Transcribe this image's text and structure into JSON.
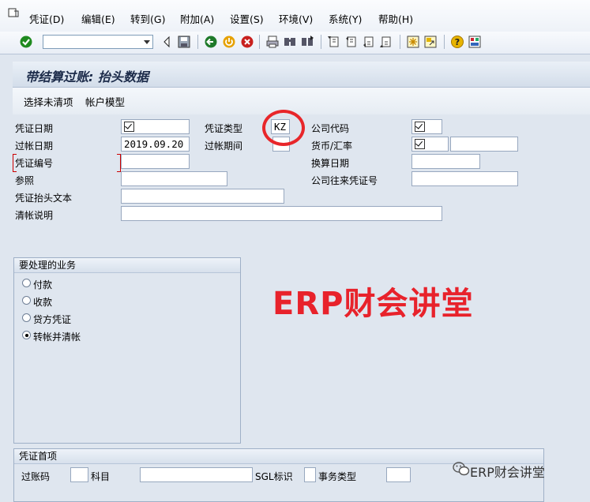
{
  "menu": [
    "凭证(D)",
    "编辑(E)",
    "转到(G)",
    "附加(A)",
    "设置(S)",
    "环境(V)",
    "系统(Y)",
    "帮助(H)"
  ],
  "toolbar": {
    "icons": [
      "enter-check-icon",
      "back-arrow-icon",
      "save-icon",
      "back-icon",
      "exit-icon",
      "cancel-icon",
      "print-icon",
      "find-icon",
      "find-next-icon",
      "first-page-icon",
      "prev-page-icon",
      "next-page-icon",
      "last-page-icon",
      "new-session-icon",
      "shortcut-icon",
      "help-icon",
      "customize-layout-icon"
    ],
    "command_value": ""
  },
  "title": "带结算过账: 抬头数据",
  "app_toolbar": {
    "select_open_items": "选择未清项",
    "account_model": "帐户模型"
  },
  "form": {
    "doc_date_label": "凭证日期",
    "doc_date_value": "",
    "doc_type_label": "凭证类型",
    "doc_type_value": "KZ",
    "company_code_label": "公司代码",
    "company_code_value": "",
    "posting_date_label": "过帐日期",
    "posting_date_value": "2019.09.20",
    "period_label": "过帐期间",
    "period_value": "",
    "currency_label": "货币/汇率",
    "currency_value": "",
    "rate_value": "",
    "doc_number_label": "凭证编号",
    "doc_number_value": "",
    "translation_date_label": "换算日期",
    "translation_date_value": "",
    "reference_label": "参照",
    "reference_value": "",
    "cross_company_label": "公司往来凭证号",
    "cross_company_value": "",
    "header_text_label": "凭证抬头文本",
    "header_text_value": "",
    "clearing_text_label": "清帐说明",
    "clearing_text_value": ""
  },
  "transactions": {
    "title": "要处理的业务",
    "options": [
      "付款",
      "收款",
      "贷方凭证",
      "转帐并清帐"
    ],
    "selected": "转帐并清帐"
  },
  "first_line": {
    "title": "凭证首项",
    "posting_key_label": "过账码",
    "posting_key_value": "",
    "account_label": "科目",
    "account_value": "",
    "sgl_label": "SGL标识",
    "sgl_value": "",
    "trans_type_label": "事务类型",
    "trans_type_value": ""
  },
  "watermark": {
    "text": "ERP财会讲堂",
    "footer": "ERP财会讲堂"
  },
  "colors": {
    "highlight": "#e8262a",
    "watermark": "#e8222b"
  }
}
